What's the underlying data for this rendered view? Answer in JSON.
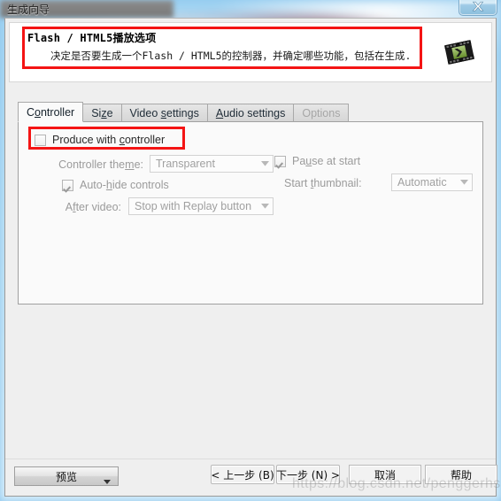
{
  "window": {
    "title": "生成向导",
    "close_icon": "close-x-icon"
  },
  "header": {
    "title": "Flash / HTML5播放选项",
    "description": "决定是否要生成一个Flash / HTML5的控制器，并确定哪些功能，包括在生成.",
    "app_icon": "camtasia-video-icon",
    "highlight_color": "#f41414"
  },
  "tabs": [
    {
      "label": "Controller",
      "accel": "o",
      "active": true,
      "disabled": false
    },
    {
      "label": "Size",
      "accel": "z",
      "active": false,
      "disabled": false
    },
    {
      "label": "Video settings",
      "accel": "s",
      "active": false,
      "disabled": false
    },
    {
      "label": "Audio settings",
      "accel": "A",
      "active": false,
      "disabled": false
    },
    {
      "label": "Options",
      "accel": "",
      "active": false,
      "disabled": true
    }
  ],
  "controller_tab": {
    "produce_with_controller": {
      "label_pre": "Produce with ",
      "label_accel": "c",
      "label_post": "ontroller",
      "checked": false,
      "highlighted": true
    },
    "controller_theme": {
      "label_pre": "Controller the",
      "label_accel": "m",
      "label_post": "e:",
      "value": "Transparent",
      "enabled": false,
      "arrow_icon": "chevron-down-icon"
    },
    "auto_hide_controls": {
      "label_pre": "Auto-",
      "label_accel": "h",
      "label_post": "ide controls",
      "checked": true,
      "enabled": false
    },
    "after_video": {
      "label_pre": "A",
      "label_accel": "f",
      "label_post": "ter video:",
      "value": "Stop with Replay button",
      "enabled": false,
      "arrow_icon": "chevron-down-icon"
    },
    "pause_at_start": {
      "label_pre": "Pa",
      "label_accel": "u",
      "label_post": "se at start",
      "checked": true,
      "enabled": false
    },
    "start_thumbnail": {
      "label_pre": "Start ",
      "label_accel": "t",
      "label_post": "humbnail:",
      "value": "Automatic",
      "enabled": false,
      "arrow_icon": "chevron-down-icon"
    }
  },
  "footer": {
    "preview_label": "预览",
    "preview_arrow_icon": "caret-down-icon",
    "back_label": "< 上一步 (B)",
    "next_label": "下一步 (N) >",
    "cancel_label": "取消",
    "help_label": "帮助"
  },
  "watermark": "https://blog.csdn.net/penggerhs"
}
